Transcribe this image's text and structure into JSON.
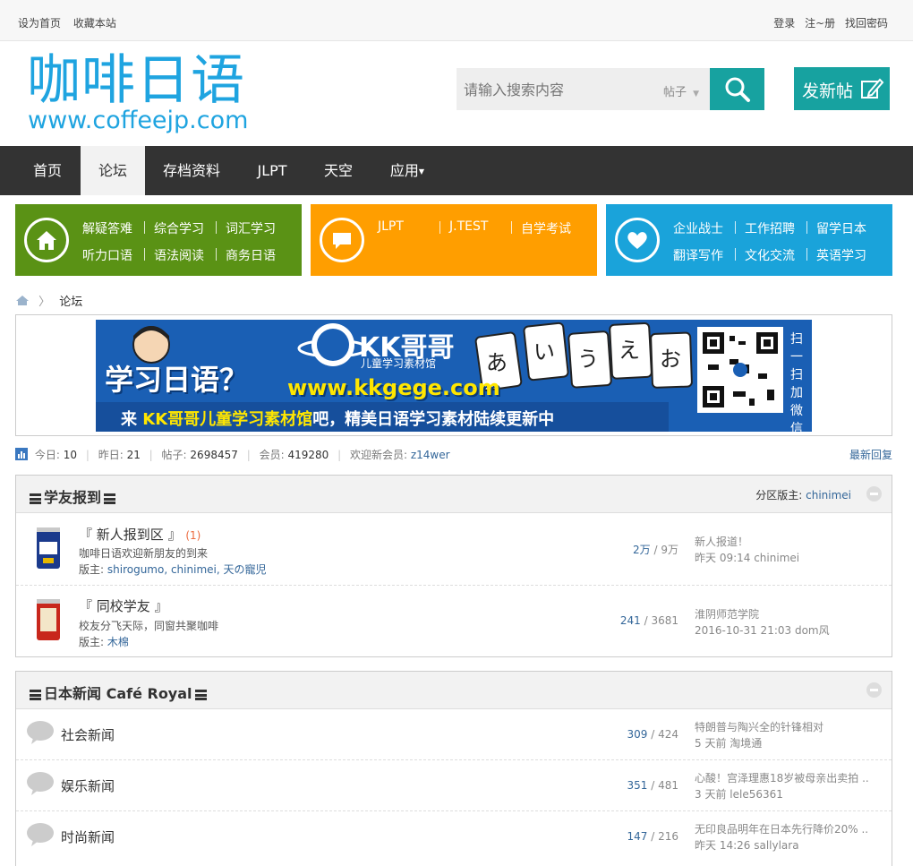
{
  "topbar": {
    "set_home": "设为首页",
    "bookmark": "收藏本站",
    "login": "登录",
    "register": "注~册",
    "recover": "找回密码"
  },
  "header": {
    "logo_cn": "咖啡日语",
    "logo_en": "www.coffeejp.com",
    "search_placeholder": "请输入搜索内容",
    "search_type": "帖子",
    "new_post": "发新帖"
  },
  "nav": {
    "items": [
      "首页",
      "论坛",
      "存档资料",
      "JLPT",
      "天空",
      "应用"
    ],
    "active": "论坛"
  },
  "categories": {
    "green": {
      "color": "#5a9215",
      "links": [
        "解疑答难",
        "综合学习",
        "词汇学习",
        "听力口语",
        "语法阅读",
        "商务日语"
      ]
    },
    "orange": {
      "color": "#ff9e00",
      "links": [
        "JLPT",
        "J.TEST",
        "自学考试"
      ]
    },
    "blue": {
      "color": "#1aa3da",
      "links": [
        "企业战士",
        "工作招聘",
        "留学日本",
        "翻译写作",
        "文化交流",
        "英语学习"
      ]
    }
  },
  "breadcrumb": {
    "current": "论坛"
  },
  "banner": {
    "headline": "学习日语？",
    "brand": "KK哥哥",
    "brand_sub": "儿童学习素材馆",
    "url": "www.kkgege.com",
    "tagline_pre": "来",
    "tagline_brand": "KK哥哥儿童学习素材馆",
    "tagline_post": "吧，精美日语学习素材陆续更新中",
    "kana": [
      "あ",
      "い",
      "う",
      "え",
      "お"
    ],
    "qr_text": "扫一扫加微信"
  },
  "stats": {
    "today_label": "今日:",
    "today": "10",
    "yesterday_label": "昨日:",
    "yesterday": "21",
    "posts_label": "帖子:",
    "posts": "2698457",
    "members_label": "会员:",
    "members": "419280",
    "welcome_label": "欢迎新会员:",
    "newest_member": "z14wer",
    "latest_reply": "最新回复"
  },
  "sections": [
    {
      "title": "学友报到",
      "moderator_label": "分区版主:",
      "moderator": "chinimei",
      "forums": [
        {
          "name": "『 新人报到区 』",
          "today": "(1)",
          "desc": "咖啡日语欢迎新朋友的到来",
          "mod_label": "版主:",
          "mods": "shirogumo, chinimei, 天の寵児",
          "threads": "2万",
          "posts": "9万",
          "last_title": "新人报道！",
          "last_meta": "昨天 09:14 chinimei"
        },
        {
          "name": "『 同校学友 』",
          "desc": "校友分飞天际，同窗共聚咖啡",
          "mod_label": "版主:",
          "mods": "木棉",
          "threads": "241",
          "posts": "3681",
          "last_title": "淮阴师范学院",
          "last_meta": "2016-10-31 21:03 dom风"
        }
      ]
    },
    {
      "title": "日本新闻 Café Royal",
      "forums": [
        {
          "name": "社会新闻",
          "threads": "309",
          "posts": "424",
          "last_title": "特朗普与陶兴全的针锋相对",
          "last_meta": "5 天前 淘境通"
        },
        {
          "name": "娱乐新闻",
          "threads": "351",
          "posts": "481",
          "last_title": "心酸！宫泽理惠18岁被母亲出卖拍 ...",
          "last_meta": "3 天前 lele56361"
        },
        {
          "name": "时尚新闻",
          "threads": "147",
          "posts": "216",
          "last_title": "无印良品明年在日本先行降价20% ...",
          "last_meta": "昨天 14:26 sallylara"
        }
      ]
    }
  ]
}
